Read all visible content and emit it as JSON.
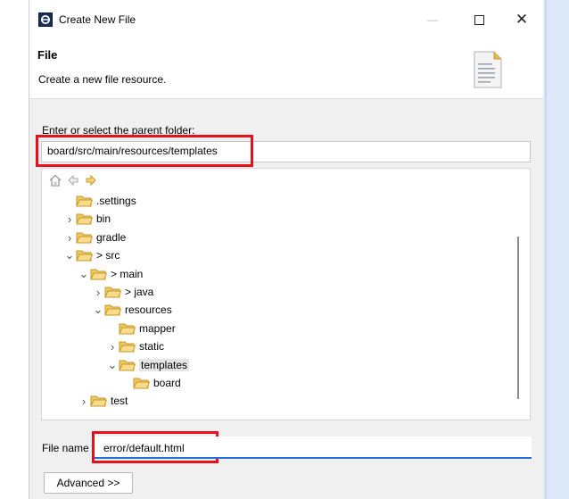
{
  "window": {
    "title": "Create New File",
    "min_glyph": "—",
    "max_glyph": "☐",
    "close_glyph": "✕"
  },
  "header": {
    "title": "File",
    "description": "Create a new file resource."
  },
  "parent": {
    "label": "Enter or select the parent folder:",
    "value": "board/src/main/resources/templates"
  },
  "tree": {
    "items": [
      {
        "label": ".settings",
        "level": 1,
        "expander": "none"
      },
      {
        "label": "bin",
        "level": 1,
        "expander": "collapsed"
      },
      {
        "label": "gradle",
        "level": 1,
        "expander": "collapsed"
      },
      {
        "label": "> src",
        "level": 1,
        "expander": "expanded"
      },
      {
        "label": "> main",
        "level": 2,
        "expander": "expanded"
      },
      {
        "label": "> java",
        "level": 3,
        "expander": "collapsed"
      },
      {
        "label": "resources",
        "level": 3,
        "expander": "expanded"
      },
      {
        "label": "mapper",
        "level": 4,
        "expander": "none"
      },
      {
        "label": "static",
        "level": 4,
        "expander": "collapsed"
      },
      {
        "label": "templates",
        "level": 4,
        "expander": "expanded",
        "selected": true
      },
      {
        "label": "board",
        "level": 5,
        "expander": "none"
      },
      {
        "label": "test",
        "level": 2,
        "expander": "collapsed"
      }
    ]
  },
  "file_name": {
    "label": "File name",
    "value": "error/default.html"
  },
  "advanced_label": "Advanced >>",
  "colors": {
    "highlight_box": "#e8101c",
    "input_focus": "#2a6ed8",
    "folder": "#e6b84a"
  }
}
